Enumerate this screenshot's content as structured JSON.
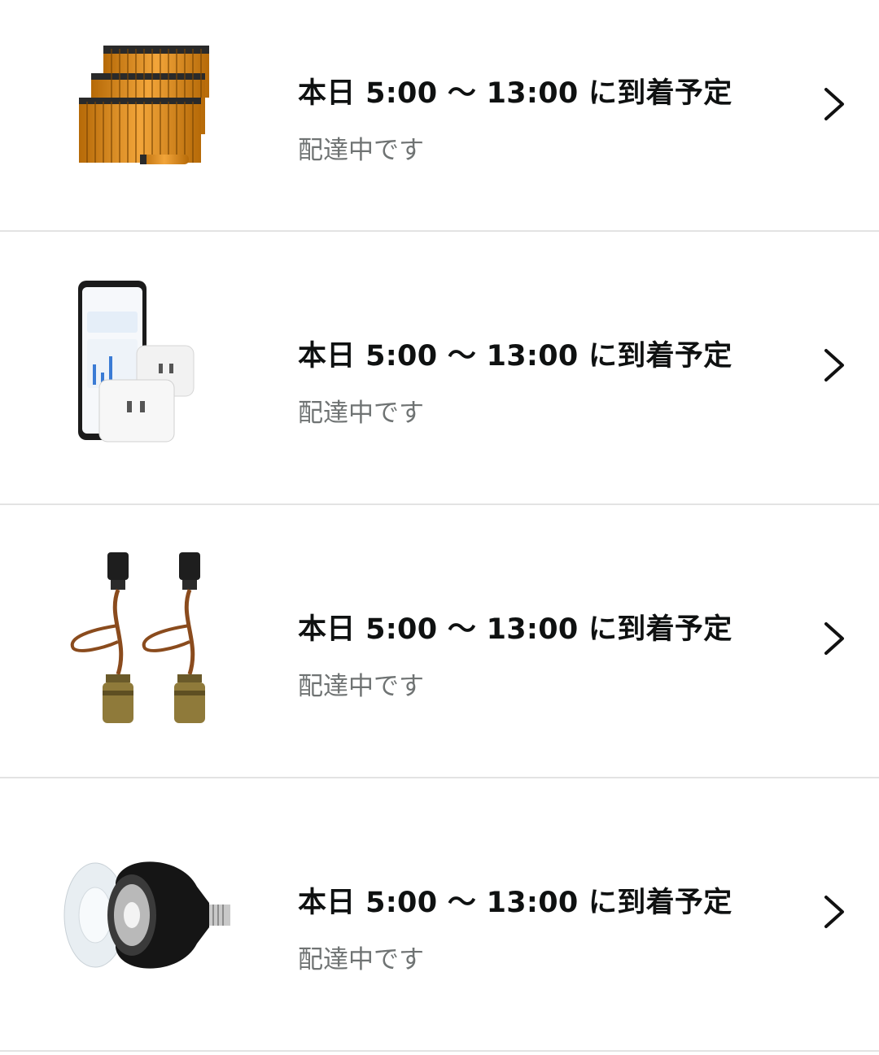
{
  "deliveries": [
    {
      "arrival": "本日 5:00 〜 13:00 に到着予定",
      "status": "配達中です",
      "image": "aa-batteries-pack"
    },
    {
      "arrival": "本日 5:00 〜 13:00 に到着予定",
      "status": "配達中です",
      "image": "smart-plugs-with-phone"
    },
    {
      "arrival": "本日 5:00 〜 13:00 に到着予定",
      "status": "配達中です",
      "image": "pendant-light-sockets"
    },
    {
      "arrival": "本日 5:00 〜 13:00 に到着予定",
      "status": "配達中です",
      "image": "black-led-spot-bulb"
    }
  ],
  "icons": {
    "chevron": "chevron-right-icon"
  },
  "colors": {
    "title": "#0f1111",
    "status": "#6f7373",
    "divider": "#e3e3e3"
  }
}
